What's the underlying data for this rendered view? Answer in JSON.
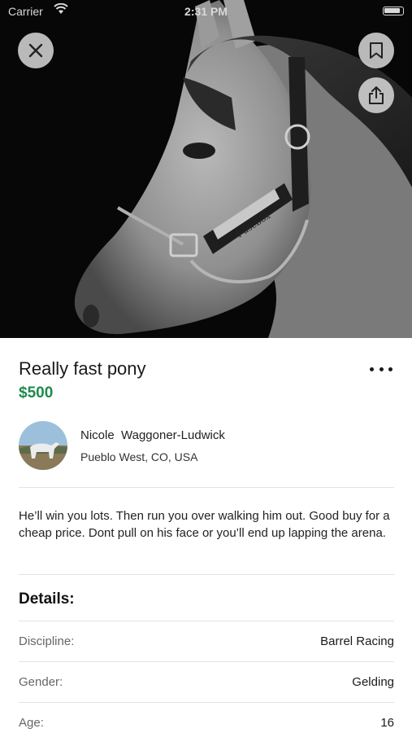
{
  "status_bar": {
    "carrier": "Carrier",
    "time": "2:31 PM"
  },
  "hero": {
    "photo_label": "horse-photo",
    "halter_plate_text": "Fusebox"
  },
  "listing": {
    "title": "Really fast pony",
    "price": "$500",
    "accent_color": "#1f8a4c"
  },
  "seller": {
    "name": "Nicole  Waggoner-Ludwick",
    "location": "Pueblo West, CO, USA"
  },
  "description": "He’ll win you lots. Then run you over walking him out. Good buy for a cheap price. Dont pull on his face or you’ll end up lapping the arena.",
  "details": {
    "heading": "Details:",
    "rows": [
      {
        "label": "Discipline:",
        "value": "Barrel Racing"
      },
      {
        "label": "Gender:",
        "value": "Gelding"
      },
      {
        "label": "Age:",
        "value": "16"
      }
    ]
  },
  "icons": {
    "close": "close-icon",
    "bookmark": "bookmark-icon",
    "share": "share-icon",
    "more": "more-options-icon"
  }
}
